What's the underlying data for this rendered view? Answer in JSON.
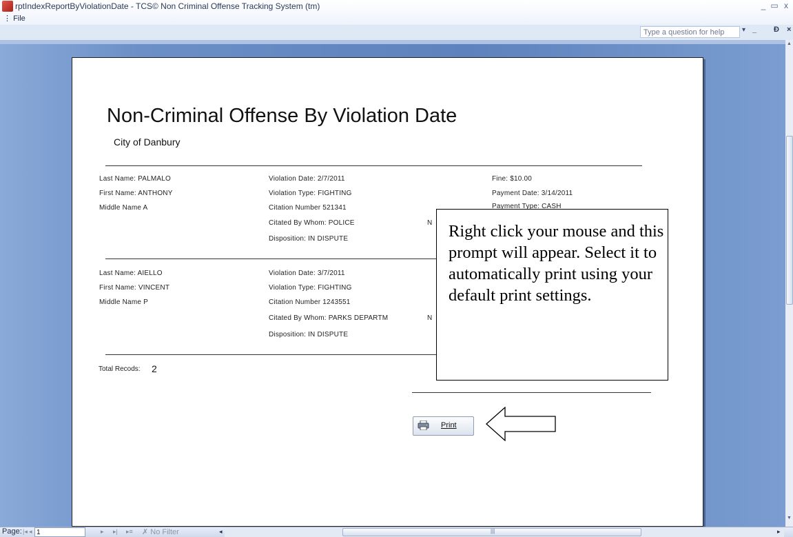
{
  "window": {
    "title": "rptIndexReportByViolationDate - TCS© Non Criminal Offense Tracking System (tm)",
    "minimize_glyph": "_",
    "restore_glyph": "▭",
    "close_glyph": "x"
  },
  "menu": {
    "file_label": "File",
    "help_placeholder": "Type a question for help",
    "help_dropdown": "▾",
    "mdi_minimize": "_",
    "mdi_restore": "Ɖ",
    "mdi_close": "×"
  },
  "report": {
    "title": "Non-Criminal Offense By Violation Date",
    "subtitle": "City of Danbury",
    "records": [
      {
        "last_name": "Last Name:  PALMALO",
        "first_name": "First Name:  ANTHONY",
        "middle_name": "Middle Name  A",
        "violation_date": "Violation Date:  2/7/2011",
        "violation_type": "Violation Type:  FIGHTING",
        "citation_number": "Citation Number  521341",
        "cited_by": "Citated By Whom:   POLICE",
        "cited_by_extra": "N",
        "disposition": "Disposition:    IN DISPUTE",
        "fine": "Fine:    $10.00",
        "payment_date": "Payment Date:  3/14/2011",
        "payment_type": "Payment Type:   CASH"
      },
      {
        "last_name": "Last Name:  AIELLO",
        "first_name": "First Name:  VINCENT",
        "middle_name": "Middle Name  P",
        "violation_date": "Violation Date:  3/7/2011",
        "violation_type": "Violation Type:  FIGHTING",
        "citation_number": "Citation Number  1243551",
        "cited_by": "Citated By Whom:   PARKS DEPARTM",
        "cited_by_extra": "N",
        "disposition": "Disposition:    IN DISPUTE"
      }
    ],
    "total_label": "Total Recods:",
    "total_value": "2",
    "print_button_label": "Print"
  },
  "callout": {
    "text": "Right click your mouse and this prompt will appear. Select it to automatically print using your default print settings."
  },
  "statusbar": {
    "page_label": "Page:",
    "nav_first": "|◂",
    "nav_prev": "◂",
    "page_value": "1",
    "nav_next": "▸",
    "nav_last": "▸|",
    "nav_new": "▸≡",
    "filter_label": "No Filter",
    "filter_icon": "funnel-x-icon",
    "scroll_left": "◂",
    "scroll_right": "▸",
    "scroll_grip": "|||"
  },
  "colors": {
    "workspace": "#5d82bd",
    "page": "#ffffff",
    "titlebar_text": "#2c3a58"
  }
}
